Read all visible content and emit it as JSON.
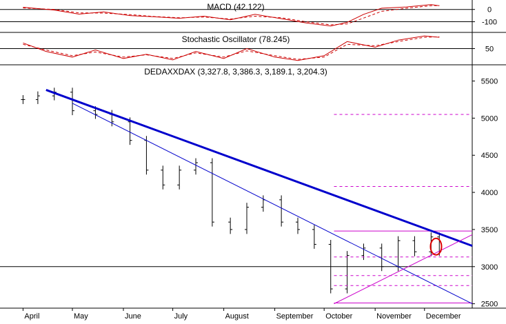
{
  "chart_data": [
    {
      "type": "line",
      "panel": "macd",
      "title": "MACD (42.122)",
      "yticks": [
        0,
        -100
      ],
      "ylim": [
        -170,
        60
      ],
      "colors": {
        "macd": "#cc0000",
        "signal": "#cc0000"
      },
      "series": [
        {
          "style": "solid",
          "x": [
            "2002-04-01",
            "2002-04-20",
            "2002-05-05",
            "2002-05-20",
            "2002-06-05",
            "2002-06-20",
            "2002-07-05",
            "2002-07-20",
            "2002-08-05",
            "2002-08-20",
            "2002-09-05",
            "2002-09-20",
            "2002-10-05",
            "2002-10-15",
            "2002-10-25",
            "2002-11-05",
            "2002-11-20",
            "2002-12-05",
            "2002-12-10"
          ],
          "values": [
            18,
            -5,
            -38,
            -20,
            -50,
            -60,
            -72,
            -55,
            -85,
            -40,
            -75,
            -110,
            -135,
            -105,
            -40,
            10,
            20,
            40,
            30
          ]
        },
        {
          "style": "dashed",
          "x": [
            "2002-04-01",
            "2002-04-20",
            "2002-05-05",
            "2002-05-20",
            "2002-06-05",
            "2002-06-20",
            "2002-07-05",
            "2002-07-20",
            "2002-08-05",
            "2002-08-20",
            "2002-09-05",
            "2002-09-20",
            "2002-10-05",
            "2002-10-15",
            "2002-10-25",
            "2002-11-05",
            "2002-11-20",
            "2002-12-05",
            "2002-12-10"
          ],
          "values": [
            12,
            0,
            -28,
            -30,
            -42,
            -58,
            -68,
            -62,
            -78,
            -55,
            -68,
            -100,
            -125,
            -118,
            -70,
            -15,
            10,
            30,
            32
          ]
        }
      ]
    },
    {
      "type": "line",
      "panel": "stochastic",
      "title": "Stochastic Oscillator (78.245)",
      "yticks": [
        50
      ],
      "ylim": [
        0,
        100
      ],
      "colors": {
        "k": "#cc0000",
        "d": "#cc0000"
      },
      "series": [
        {
          "style": "solid",
          "x": [
            "2002-04-01",
            "2002-04-15",
            "2002-05-01",
            "2002-05-15",
            "2002-06-01",
            "2002-06-15",
            "2002-07-01",
            "2002-07-15",
            "2002-08-01",
            "2002-08-15",
            "2002-09-01",
            "2002-09-15",
            "2002-10-01",
            "2002-10-15",
            "2002-11-01",
            "2002-11-15",
            "2002-12-01",
            "2002-12-10"
          ],
          "values": [
            70,
            40,
            20,
            45,
            15,
            30,
            10,
            40,
            15,
            50,
            20,
            8,
            25,
            75,
            55,
            80,
            95,
            90
          ]
        },
        {
          "style": "dashed",
          "x": [
            "2002-04-01",
            "2002-04-15",
            "2002-05-01",
            "2002-05-15",
            "2002-06-01",
            "2002-06-15",
            "2002-07-01",
            "2002-07-15",
            "2002-08-01",
            "2002-08-15",
            "2002-09-01",
            "2002-09-15",
            "2002-10-01",
            "2002-10-15",
            "2002-11-01",
            "2002-11-15",
            "2002-12-01",
            "2002-12-10"
          ],
          "values": [
            65,
            45,
            25,
            38,
            20,
            28,
            15,
            35,
            20,
            42,
            25,
            12,
            20,
            65,
            60,
            75,
            90,
            92
          ]
        }
      ]
    },
    {
      "type": "line",
      "panel": "price",
      "title": "DEDAXXDAX (3,327.8, 3,386.3, 3,189.1, 3,204.3)",
      "x_tick_labels": [
        "April",
        "May",
        "June",
        "July",
        "August",
        "September",
        "October",
        "November",
        "December"
      ],
      "x_tick_dates": [
        "2002-04-01",
        "2002-05-01",
        "2002-06-01",
        "2002-07-01",
        "2002-08-01",
        "2002-09-01",
        "2002-10-01",
        "2002-11-01",
        "2002-12-01"
      ],
      "yticks": [
        5500,
        5000,
        4500,
        4000,
        3500,
        3000,
        2500
      ],
      "ylim": [
        2450,
        5700
      ],
      "reference_level": 3000,
      "series": [
        {
          "style": "bars",
          "x": [
            "2002-04-01",
            "2002-04-10",
            "2002-04-20",
            "2002-05-01",
            "2002-05-15",
            "2002-05-25",
            "2002-06-05",
            "2002-06-15",
            "2002-06-25",
            "2002-07-05",
            "2002-07-15",
            "2002-07-25",
            "2002-08-05",
            "2002-08-15",
            "2002-08-25",
            "2002-09-05",
            "2002-09-15",
            "2002-09-25",
            "2002-10-05",
            "2002-10-15",
            "2002-10-25",
            "2002-11-05",
            "2002-11-15",
            "2002-11-25",
            "2002-12-05",
            "2002-12-10"
          ],
          "values": [
            5250,
            5300,
            5350,
            5100,
            5050,
            4950,
            4700,
            4300,
            4100,
            4300,
            4400,
            3600,
            3500,
            3800,
            3900,
            3600,
            3500,
            3300,
            2700,
            3150,
            3250,
            3000,
            3350,
            3200,
            3400,
            3204.3
          ]
        }
      ],
      "trendlines": [
        {
          "name": "thick",
          "color": "#0000cc",
          "from": [
            "2002-04-15",
            5380
          ],
          "to": [
            "2002-12-30",
            3280
          ]
        },
        {
          "name": "thin",
          "color": "#0000cc",
          "from": [
            "2002-05-01",
            5200
          ],
          "to": [
            "2002-12-30",
            2500
          ]
        },
        {
          "name": "rising",
          "color": "#cc00cc",
          "from": [
            "2002-10-07",
            2500
          ],
          "to": [
            "2002-12-30",
            3430
          ]
        }
      ],
      "fibonacci_levels": {
        "color": "#cc00cc",
        "dashed": [
          5050,
          4080,
          3130,
          2880,
          2745
        ],
        "solid": [
          3480,
          2510
        ]
      },
      "highlight_circle": {
        "x": "2002-12-08",
        "y": 3270
      }
    }
  ]
}
